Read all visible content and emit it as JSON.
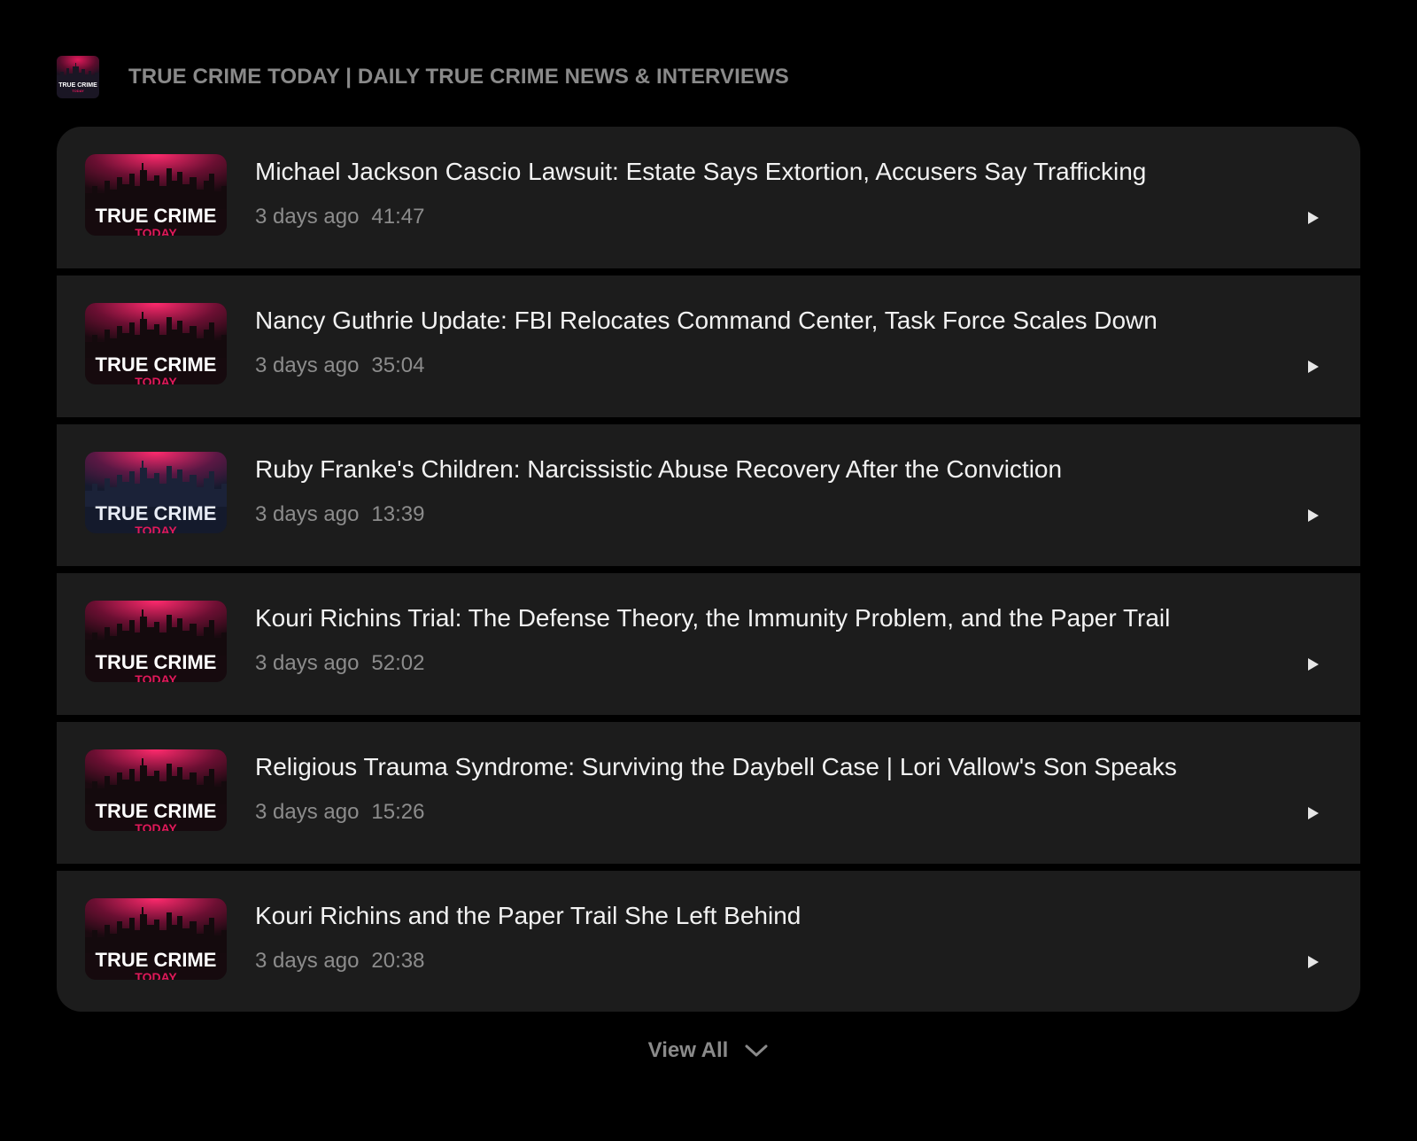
{
  "podcast": {
    "title": "TRUE CRIME TODAY | DAILY TRUE CRIME NEWS & INTERVIEWS",
    "logo_icon": "true-crime-today-logo",
    "logo_text": "TRUE CRIME",
    "logo_subtext": "TODAY"
  },
  "episodes": [
    {
      "title": "Michael Jackson Cascio Lawsuit: Estate Says Extortion, Accusers Say Trafficking",
      "date": "3 days ago",
      "duration": "41:47",
      "play_icon": "play-icon"
    },
    {
      "title": "Nancy Guthrie Update: FBI Relocates Command Center, Task Force Scales Down",
      "date": "3 days ago",
      "duration": "35:04",
      "play_icon": "play-icon"
    },
    {
      "title": "Ruby Franke's Children: Narcissistic Abuse Recovery After the Conviction",
      "date": "3 days ago",
      "duration": "13:39",
      "play_icon": "play-icon"
    },
    {
      "title": "Kouri Richins Trial: The Defense Theory, the Immunity Problem, and the Paper Trail",
      "date": "3 days ago",
      "duration": "52:02",
      "play_icon": "play-icon"
    },
    {
      "title": "Religious Trauma Syndrome: Surviving the Daybell Case | Lori Vallow's Son Speaks",
      "date": "3 days ago",
      "duration": "15:26",
      "play_icon": "play-icon"
    },
    {
      "title": "Kouri Richins and the Paper Trail She Left Behind",
      "date": "3 days ago",
      "duration": "20:38",
      "play_icon": "play-icon"
    }
  ],
  "view_all": {
    "label": "View All",
    "icon": "chevron-down-icon"
  },
  "colors": {
    "background": "#000000",
    "card": "#1c1c1c",
    "accent": "#e0195a",
    "muted_text": "#8a8a8a",
    "title_text": "#f2f2f2"
  }
}
